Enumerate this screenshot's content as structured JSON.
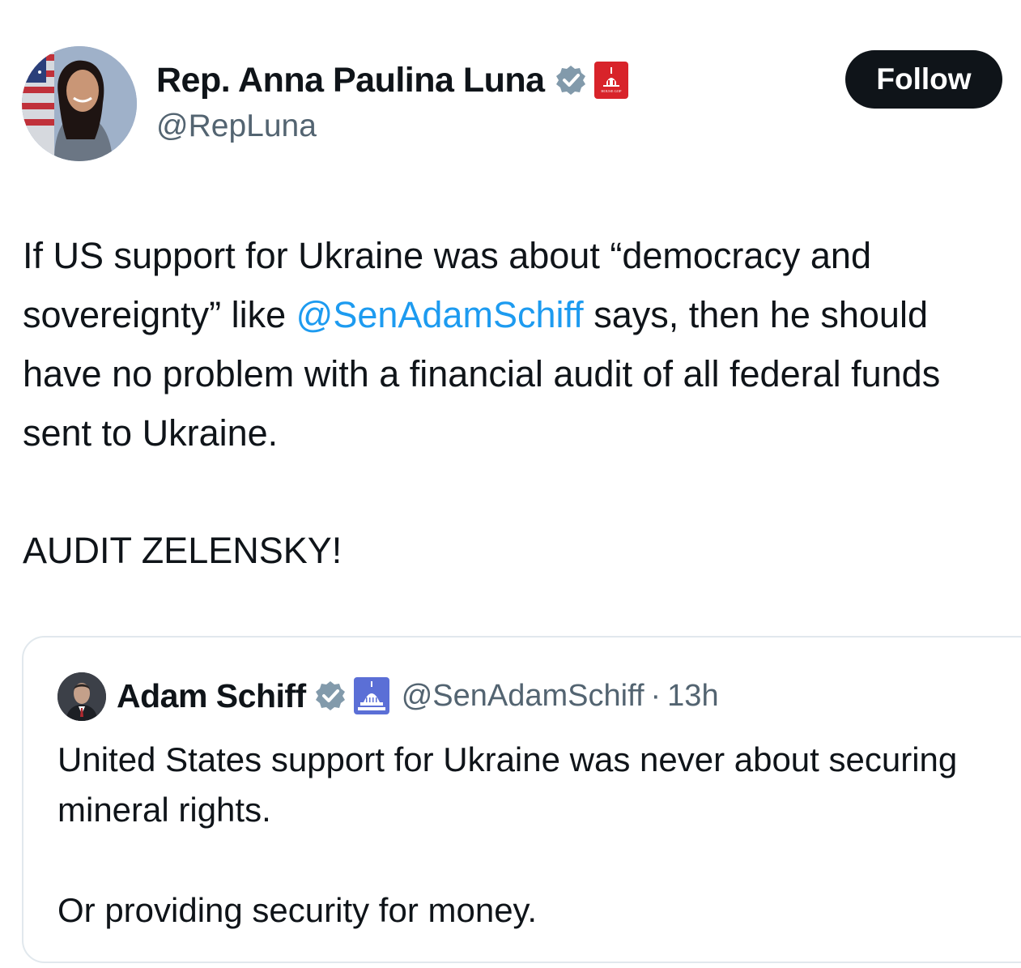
{
  "author": {
    "display_name": "Rep. Anna Paulina Luna",
    "handle": "@RepLuna",
    "avatar_icon": "profile-photo",
    "verified_icon": "verified-badge-icon",
    "org_badge_icon": "house-gop-badge-icon",
    "org_badge_text": "HOUSE GOP"
  },
  "follow": {
    "label": "Follow"
  },
  "tweet": {
    "segments": [
      "If US support for Ukraine was about “democracy and sovereignty” like ",
      "@SenAdamSchiff",
      " says, then he should have no problem with a financial audit of all federal funds sent to Ukraine."
    ],
    "closing": "AUDIT ZELENSKY!"
  },
  "quoted": {
    "display_name": "Adam Schiff",
    "handle": "@SenAdamSchiff",
    "separator": "·",
    "timestamp": "13h",
    "lines": [
      "United States support for Ukraine was never about securing mineral rights.",
      "Or providing security for money."
    ],
    "verified_icon": "verified-badge-icon",
    "gov_badge_icon": "capitol-dome-icon"
  },
  "colors": {
    "link": "#1d9bf0",
    "text": "#0f1419",
    "muted": "#536471",
    "follow_bg": "#0f1419",
    "org_badge_red": "#d8232a",
    "gov_badge_blue": "#5b6fd6"
  }
}
